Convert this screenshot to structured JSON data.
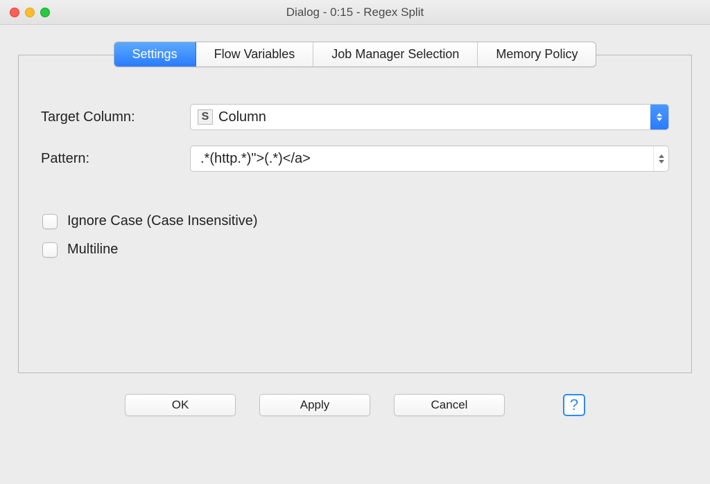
{
  "window": {
    "title": "Dialog - 0:15 - Regex Split"
  },
  "tabs": {
    "items": [
      {
        "label": "Settings",
        "active": true
      },
      {
        "label": "Flow Variables",
        "active": false
      },
      {
        "label": "Job Manager Selection",
        "active": false
      },
      {
        "label": "Memory Policy",
        "active": false
      }
    ]
  },
  "settings": {
    "target_column_label": "Target Column:",
    "target_column_value": "Column",
    "target_column_type_glyph": "S",
    "pattern_label": "Pattern:",
    "pattern_value": ".*(http.*)\">(.*)</a>",
    "ignore_case_label": "Ignore Case (Case Insensitive)",
    "ignore_case_checked": false,
    "multiline_label": "Multiline",
    "multiline_checked": false
  },
  "buttons": {
    "ok": "OK",
    "apply": "Apply",
    "cancel": "Cancel",
    "help_glyph": "?"
  }
}
